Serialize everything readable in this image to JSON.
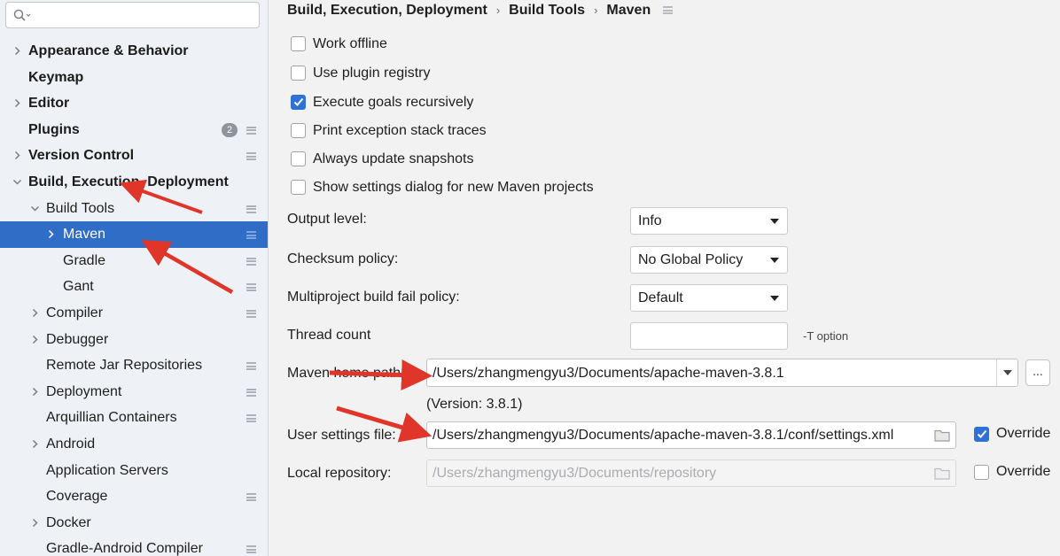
{
  "search": {
    "placeholder": ""
  },
  "sidebar": {
    "items": [
      {
        "label": "Appearance & Behavior",
        "indent": 0,
        "chevron": "right",
        "bold": true,
        "settings": false
      },
      {
        "label": "Keymap",
        "indent": 0,
        "chevron": "none",
        "bold": true,
        "settings": false
      },
      {
        "label": "Editor",
        "indent": 0,
        "chevron": "right",
        "bold": true,
        "settings": false
      },
      {
        "label": "Plugins",
        "indent": 0,
        "chevron": "none",
        "bold": true,
        "settings": true,
        "badge": "2"
      },
      {
        "label": "Version Control",
        "indent": 0,
        "chevron": "right",
        "bold": true,
        "settings": true
      },
      {
        "label": "Build, Execution, Deployment",
        "indent": 0,
        "chevron": "down",
        "bold": true,
        "settings": false
      },
      {
        "label": "Build Tools",
        "indent": 1,
        "chevron": "down",
        "bold": false,
        "settings": true
      },
      {
        "label": "Maven",
        "indent": 2,
        "chevron": "right",
        "bold": false,
        "settings": true,
        "selected": true
      },
      {
        "label": "Gradle",
        "indent": 2,
        "chevron": "none",
        "bold": false,
        "settings": true
      },
      {
        "label": "Gant",
        "indent": 2,
        "chevron": "none",
        "bold": false,
        "settings": true
      },
      {
        "label": "Compiler",
        "indent": 1,
        "chevron": "right",
        "bold": false,
        "settings": true
      },
      {
        "label": "Debugger",
        "indent": 1,
        "chevron": "right",
        "bold": false,
        "settings": false
      },
      {
        "label": "Remote Jar Repositories",
        "indent": 1,
        "chevron": "none",
        "bold": false,
        "settings": true
      },
      {
        "label": "Deployment",
        "indent": 1,
        "chevron": "right",
        "bold": false,
        "settings": true
      },
      {
        "label": "Arquillian Containers",
        "indent": 1,
        "chevron": "none",
        "bold": false,
        "settings": true
      },
      {
        "label": "Android",
        "indent": 1,
        "chevron": "right",
        "bold": false,
        "settings": false
      },
      {
        "label": "Application Servers",
        "indent": 1,
        "chevron": "none",
        "bold": false,
        "settings": false
      },
      {
        "label": "Coverage",
        "indent": 1,
        "chevron": "none",
        "bold": false,
        "settings": true
      },
      {
        "label": "Docker",
        "indent": 1,
        "chevron": "right",
        "bold": false,
        "settings": false
      },
      {
        "label": "Gradle-Android Compiler",
        "indent": 1,
        "chevron": "none",
        "bold": false,
        "settings": true
      }
    ]
  },
  "breadcrumb": {
    "items": [
      "Build, Execution, Deployment",
      "Build Tools",
      "Maven"
    ],
    "separator": "›"
  },
  "checkboxes": [
    {
      "label": "Work offline",
      "checked": false
    },
    {
      "label": "Use plugin registry",
      "checked": false
    },
    {
      "label": "Execute goals recursively",
      "checked": true
    },
    {
      "label": "Print exception stack traces",
      "checked": false
    },
    {
      "label": "Always update snapshots",
      "checked": false
    },
    {
      "label": "Show settings dialog for new Maven projects",
      "checked": false
    }
  ],
  "fields": {
    "output_level": {
      "label": "Output level:",
      "value": "Info"
    },
    "checksum_policy": {
      "label": "Checksum policy:",
      "value": "No Global Policy"
    },
    "fail_policy": {
      "label": "Multiproject build fail policy:",
      "value": "Default"
    },
    "thread_count": {
      "label": "Thread count",
      "value": "",
      "hint": "-T option"
    },
    "maven_home": {
      "label": "Maven home path:",
      "value": "/Users/zhangmengyu3/Documents/apache-maven-3.8.1",
      "browse": "...",
      "version": "(Version: 3.8.1)"
    },
    "user_settings": {
      "label": "User settings file:",
      "value": "/Users/zhangmengyu3/Documents/apache-maven-3.8.1/conf/settings.xml",
      "override_label": "Override",
      "override": true
    },
    "local_repo": {
      "label": "Local repository:",
      "value": "/Users/zhangmengyu3/Documents/repository",
      "override_label": "Override",
      "override": false
    }
  },
  "colors": {
    "selection": "#2f6dc7",
    "checkbox_on": "#2f71d6",
    "annotation_arrow": "#e0362a"
  },
  "icons": [
    "search-icon",
    "chevron-right-icon",
    "chevron-down-icon",
    "settings-icon",
    "folder-icon",
    "dropdown-arrow-icon",
    "checkmark-icon"
  ]
}
